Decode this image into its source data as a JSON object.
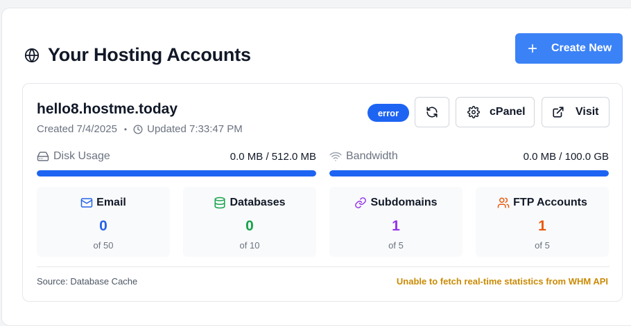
{
  "header": {
    "title": "Your Hosting Accounts",
    "create_label": "Create New"
  },
  "account": {
    "domain": "hello8.hostme.today",
    "created": "Created 7/4/2025",
    "separator": "•",
    "updated": "Updated 7:33:47 PM",
    "status": "error",
    "cpanel_label": "cPanel",
    "visit_label": "Visit",
    "disk": {
      "label": "Disk Usage",
      "value": "0.0 MB / 512.0 MB",
      "fraction": 1.0
    },
    "bandwidth": {
      "label": "Bandwidth",
      "value": "0.0 MB / 100.0 GB",
      "fraction": 1.0
    },
    "stats": [
      {
        "name": "Email",
        "count": "0",
        "limit": "of 50",
        "color": "#2563eb",
        "icon": "mail-icon"
      },
      {
        "name": "Databases",
        "count": "0",
        "limit": "of 10",
        "color": "#16a34a",
        "icon": "database-icon"
      },
      {
        "name": "Subdomains",
        "count": "1",
        "limit": "of 5",
        "color": "#9333ea",
        "icon": "link-icon"
      },
      {
        "name": "FTP Accounts",
        "count": "1",
        "limit": "of 5",
        "color": "#ea580c",
        "icon": "users-icon"
      }
    ],
    "source": "Source: Database Cache",
    "warning": "Unable to fetch real-time statistics from WHM API"
  },
  "colors": {
    "accent": "#3b82f6",
    "badge": "#1d64f2",
    "warning": "#ca8a04"
  }
}
